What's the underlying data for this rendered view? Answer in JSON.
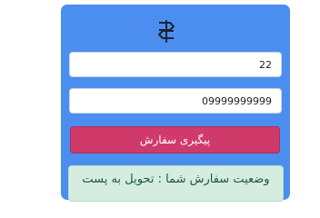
{
  "form": {
    "logo_icon": "signpost-icon",
    "order_code": "22",
    "phone": "09999999999",
    "track_button_label": "پیگیری سفارش"
  },
  "status": {
    "text": "وضعیت سفارش شما : تحویل به پست"
  },
  "colors": {
    "card": "#4b8ef0",
    "button": "#d03a6a",
    "status_bg": "#d4ede0",
    "status_text": "#1f5a3a"
  }
}
